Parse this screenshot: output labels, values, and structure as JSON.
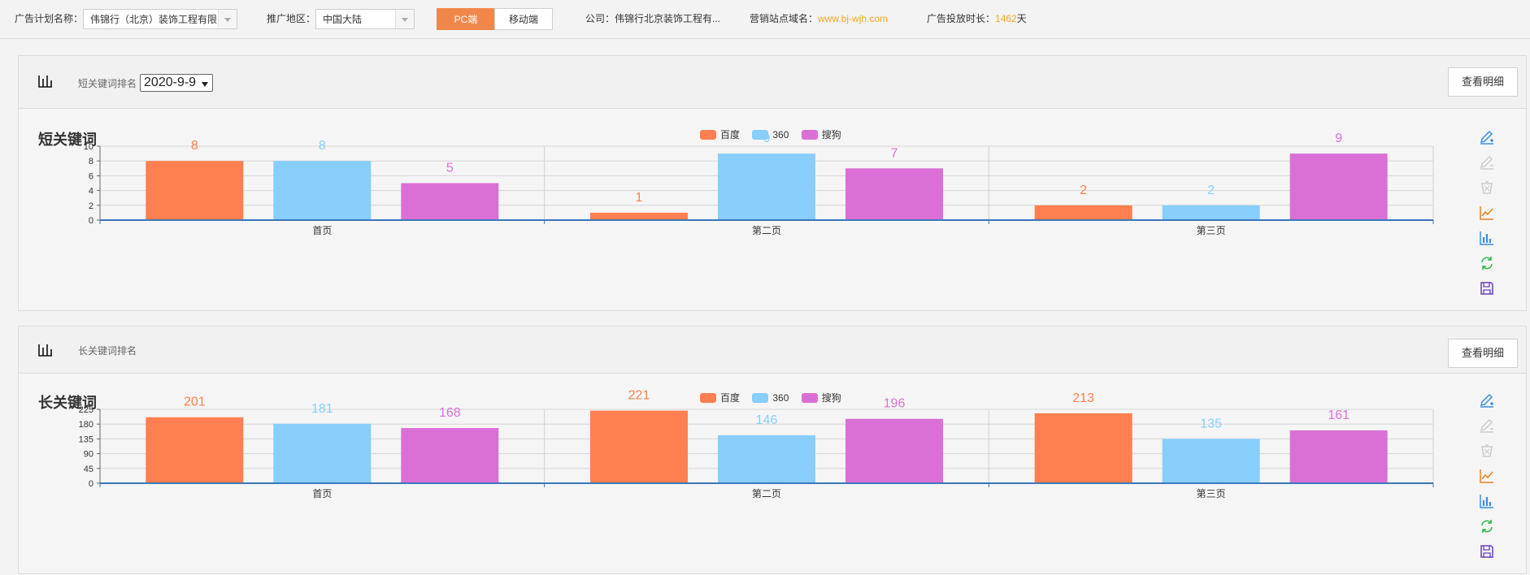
{
  "topbar": {
    "plan_label": "广告计划名称：",
    "plan_value": "伟锦行（北京）装饰工程有限公",
    "region_label": "推广地区：",
    "region_value": "中国大陆",
    "pc_label": "PC端",
    "mobile_label": "移动端",
    "company_label": "公司：",
    "company_value": "伟锦行北京装饰工程有...",
    "domain_label": "营销站点域名：",
    "domain_value": "www.bj-wjh.com",
    "duration_label": "广告投放时长：",
    "duration_value": "1462",
    "duration_unit": "天"
  },
  "colors": {
    "baidu": "#ff7f50",
    "s360": "#87cefa",
    "sogou": "#da70d6",
    "accent": "#f0874a"
  },
  "panels": [
    {
      "header_title": "短关键词排名",
      "date_value": "2020-9-9",
      "detail_label": "查看明细"
    },
    {
      "header_title": "长关键词排名",
      "detail_label": "查看明细"
    }
  ],
  "toolbox_icons": [
    "edit-pen-icon",
    "edit-pen-disabled-icon",
    "erase-disabled-icon",
    "line-chart-icon",
    "bar-chart-icon",
    "refresh-icon",
    "save-icon"
  ],
  "chart_data": [
    {
      "type": "bar",
      "title": "短关键词",
      "categories": [
        "首页",
        "第二页",
        "第三页"
      ],
      "series": [
        {
          "name": "百度",
          "values": [
            8,
            1,
            2
          ]
        },
        {
          "name": "360",
          "values": [
            8,
            9,
            2
          ]
        },
        {
          "name": "搜狗",
          "values": [
            5,
            7,
            9
          ]
        }
      ],
      "ylim": [
        0,
        10
      ],
      "yticks": [
        "0",
        "2",
        "4",
        "6",
        "8",
        "10"
      ],
      "grid": true,
      "legend": "top-center"
    },
    {
      "type": "bar",
      "title": "长关键词",
      "categories": [
        "首页",
        "第二页",
        "第三页"
      ],
      "series": [
        {
          "name": "百度",
          "values": [
            201,
            221,
            213
          ]
        },
        {
          "name": "360",
          "values": [
            181,
            146,
            135
          ]
        },
        {
          "name": "搜狗",
          "values": [
            168,
            196,
            161
          ]
        }
      ],
      "ylim": [
        0,
        225
      ],
      "yticks": [
        "0",
        "45",
        "90",
        "135",
        "180",
        "225"
      ],
      "grid": true,
      "legend": "top-center"
    }
  ]
}
